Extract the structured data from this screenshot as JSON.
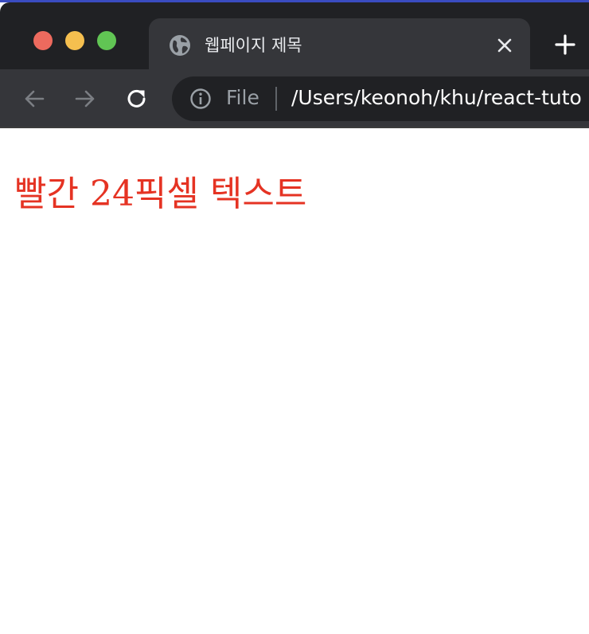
{
  "browser": {
    "tab": {
      "title": "웹페이지 제목",
      "favicon": "globe-icon"
    },
    "new_tab_icon": "plus-icon",
    "close_icon": "close-icon",
    "toolbar": {
      "back_icon": "arrow-left-icon",
      "forward_icon": "arrow-right-icon",
      "reload_icon": "reload-icon"
    },
    "address_bar": {
      "scheme_label": "File",
      "url": "/Users/keonoh/khu/react-tuto",
      "info_icon": "info-icon"
    },
    "colors": {
      "titlebar": "#202124",
      "tab_active": "#35363a",
      "traffic_red": "#ed6a5e",
      "traffic_yellow": "#f5bf4f",
      "traffic_green": "#61c554"
    }
  },
  "page": {
    "text": "빨간 24픽셀 텍스트",
    "text_color": "#e53323"
  }
}
